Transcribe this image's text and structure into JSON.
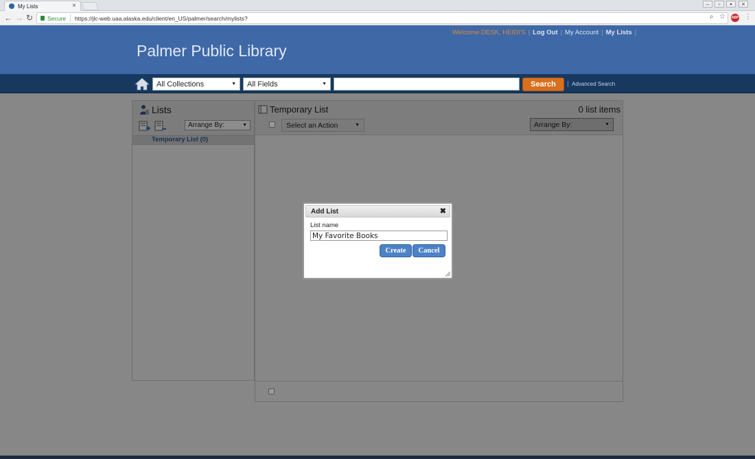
{
  "browser": {
    "tab_title": "My Lists",
    "tab_close": "×",
    "secure_label": "Secure",
    "url": "https://jlc-web.uaa.alaska.edu/client/en_US/palmer/search/mylists?",
    "abp_label": "ABP"
  },
  "header": {
    "welcome": "Welcome DESK, HEIDI'S",
    "logout": "Log Out",
    "account": "My Account",
    "mylists": "My Lists",
    "site_title": "Palmer Public Library"
  },
  "search": {
    "collection": "All Collections",
    "field": "All Fields",
    "query": "",
    "button": "Search",
    "advanced": "Advanced Search"
  },
  "lists_panel": {
    "title": "Lists",
    "arrange_by": "Arrange By:",
    "items": [
      {
        "label": "Temporary List (0)"
      }
    ]
  },
  "main_panel": {
    "title": "Temporary List",
    "count": "0 list items",
    "action": "Select an Action",
    "arrange_by": "Arrange By:"
  },
  "dialog": {
    "title": "Add List",
    "close": "✖",
    "field_label": "List name",
    "field_value": "My Favorite Books",
    "create": "Create",
    "cancel": "Cancel"
  },
  "colors": {
    "header_bg": "#3f68a6",
    "searchbar_bg": "#17385f",
    "search_button": "#d9701d",
    "dialog_button": "#4d82c8",
    "overlay": "#878787"
  }
}
